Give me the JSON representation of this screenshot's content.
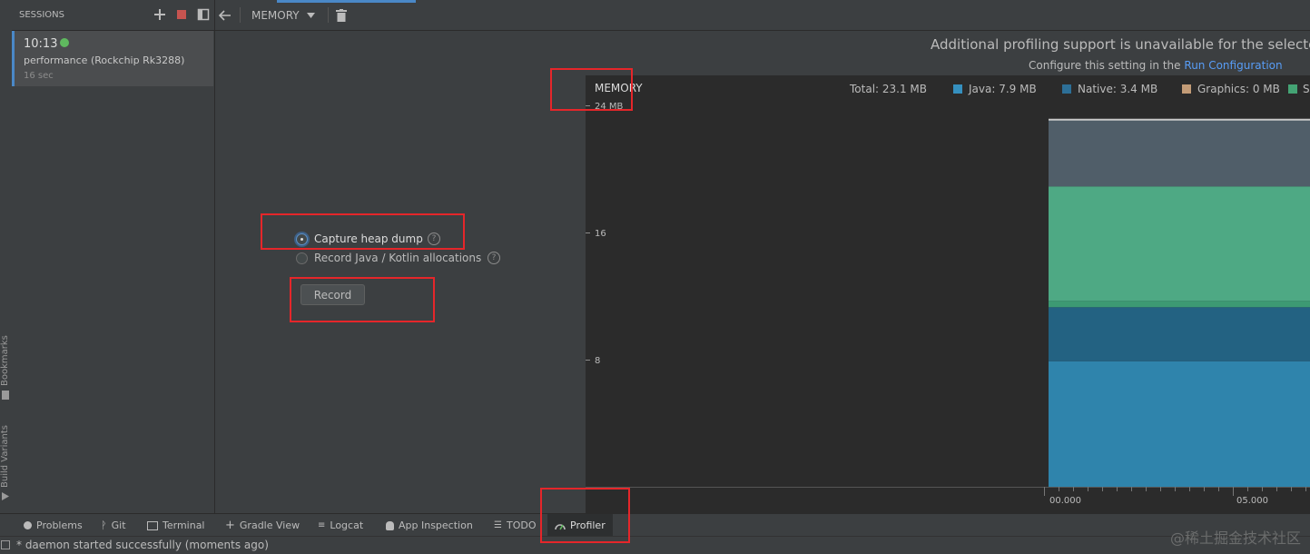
{
  "sessions": {
    "title": "SESSIONS",
    "item": {
      "time": "10:13",
      "name": "performance (Rockchip Rk3288)",
      "duration": "16 sec"
    }
  },
  "toolbar": {
    "profiler_selector": "MEMORY"
  },
  "side_labels": {
    "bookmarks": "Bookmarks",
    "build_variants": "Build Variants"
  },
  "config": {
    "option_heap_dump": "Capture heap dump",
    "option_allocations": "Record Java / Kotlin allocations",
    "record_label": "Record",
    "help_glyph": "?"
  },
  "monitor": {
    "banner_text": "Additional profiling support is unavailable for the selected",
    "config_prefix": "Configure this setting in the",
    "config_link": "Run Configuration",
    "chart_label": "MEMORY",
    "total": "Total: 23.1 MB",
    "legend": [
      {
        "label": "Java: 7.9 MB",
        "color": "#3590bf"
      },
      {
        "label": "Native: 3.4 MB",
        "color": "#2d6f97"
      },
      {
        "label": "Graphics: 0 MB",
        "color": "#c39c77"
      },
      {
        "label": "S",
        "color": "#44a374"
      }
    ]
  },
  "chart_data": {
    "type": "area",
    "title": "MEMORY",
    "ylim": [
      0,
      24
    ],
    "y_tick_labels": [
      "24 MB",
      "16",
      "8"
    ],
    "x_tick_labels": [
      "00.000",
      "05.000"
    ],
    "series": [
      {
        "name": "Java",
        "value": 7.9,
        "color": "#2f84ac"
      },
      {
        "name": "Native",
        "value": 3.4,
        "color": "#236282"
      },
      {
        "value": 0.4,
        "color": "#3d9a73"
      },
      {
        "value": 7.2,
        "color": "#4ea984"
      },
      {
        "value": 4.2,
        "color": "#505e69"
      }
    ]
  },
  "bottom_tools": {
    "problems": "Problems",
    "git": "Git",
    "terminal": "Terminal",
    "gradle_view": "Gradle View",
    "logcat": "Logcat",
    "app_inspection": "App Inspection",
    "todo": "TODO",
    "profiler": "Profiler"
  },
  "status": {
    "message": "* daemon started successfully (moments ago)"
  },
  "watermark": "@稀土掘金技术社区"
}
